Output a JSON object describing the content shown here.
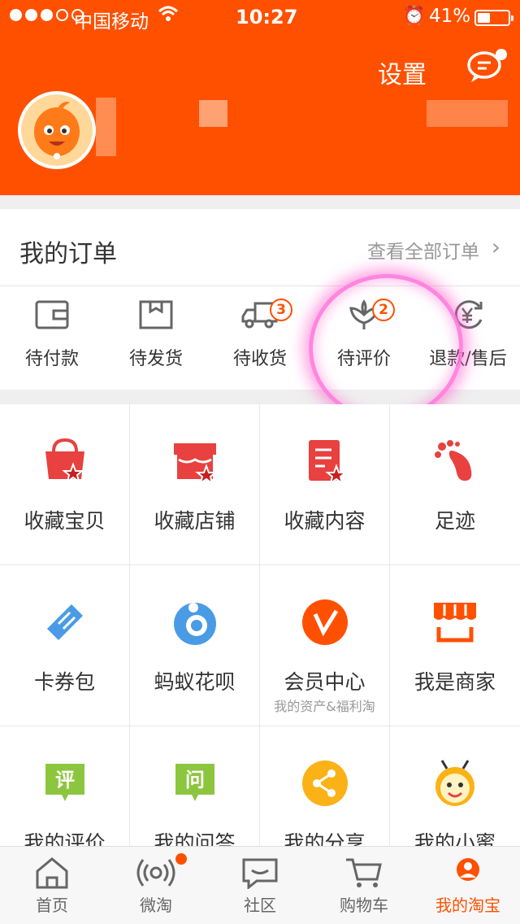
{
  "status_bar": {
    "carrier": "中国移动",
    "time": "10:27",
    "battery": "41%",
    "battery_level": 0.41
  },
  "header": {
    "settings_label": "设置"
  },
  "orders": {
    "title": "我的订单",
    "view_all": "查看全部订单",
    "items": [
      {
        "label": "待付款",
        "icon": "wallet-icon",
        "badge": ""
      },
      {
        "label": "待发货",
        "icon": "package-icon",
        "badge": ""
      },
      {
        "label": "待收货",
        "icon": "truck-icon",
        "badge": "3"
      },
      {
        "label": "待评价",
        "icon": "review-icon",
        "badge": "2"
      },
      {
        "label": "退款/售后",
        "icon": "refund-icon",
        "badge": ""
      }
    ]
  },
  "grid": [
    {
      "label": "收藏宝贝",
      "sub": "",
      "icon": "favorite-bag-icon"
    },
    {
      "label": "收藏店铺",
      "sub": "",
      "icon": "favorite-shop-icon"
    },
    {
      "label": "收藏内容",
      "sub": "",
      "icon": "favorite-content-icon"
    },
    {
      "label": "足迹",
      "sub": "",
      "icon": "footprint-icon"
    },
    {
      "label": "卡券包",
      "sub": "",
      "icon": "coupon-icon"
    },
    {
      "label": "蚂蚁花呗",
      "sub": "",
      "icon": "huabei-icon"
    },
    {
      "label": "会员中心",
      "sub": "我的资产&福利淘",
      "icon": "vip-icon"
    },
    {
      "label": "我是商家",
      "sub": "",
      "icon": "merchant-icon"
    },
    {
      "label": "我的评价",
      "sub": "",
      "icon": "my-review-icon"
    },
    {
      "label": "我的问答",
      "sub": "",
      "icon": "qa-icon"
    },
    {
      "label": "我的分享",
      "sub": "",
      "icon": "share-icon"
    },
    {
      "label": "我的小蜜",
      "sub": "",
      "icon": "assistant-icon"
    }
  ],
  "tabbar": [
    {
      "label": "首页",
      "icon": "home-icon"
    },
    {
      "label": "微淘",
      "icon": "broadcast-icon"
    },
    {
      "label": "社区",
      "icon": "chat-icon"
    },
    {
      "label": "购物车",
      "icon": "cart-icon"
    },
    {
      "label": "我的淘宝",
      "icon": "profile-icon",
      "active": true
    }
  ],
  "colors": {
    "brand": "#ff5000",
    "red": "#e8413f",
    "blue": "#4a9be6",
    "green": "#8cc63f",
    "amber": "#fbb217"
  }
}
